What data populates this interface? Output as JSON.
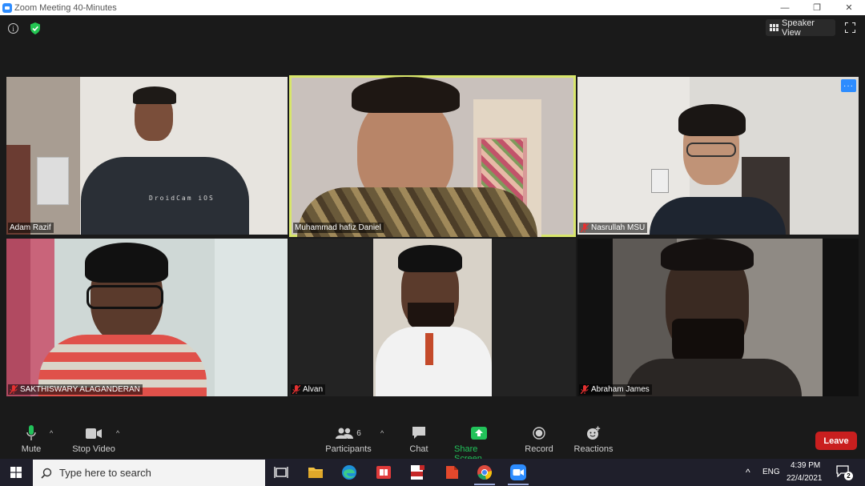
{
  "window": {
    "title": "Zoom Meeting 40-Minutes",
    "controls": [
      "—",
      "❐",
      "✕"
    ]
  },
  "header": {
    "info_glyph": "i",
    "speaker_view_label": "Speaker View"
  },
  "participants": [
    {
      "name": "Adam Razif",
      "muted": false
    },
    {
      "name": "Muhammad hafiz Daniel",
      "muted": false,
      "active_speaker": true
    },
    {
      "name": "Nasrullah MSU",
      "muted": true
    },
    {
      "name": "SAKTHISWARY ALAGANDERAN",
      "muted": true
    },
    {
      "name": "Alvan",
      "muted": true
    },
    {
      "name": "Abraham James",
      "muted": true
    }
  ],
  "shirt_print": "DroidCam iOS",
  "more_glyph": "···",
  "toolbar": {
    "mute_label": "Mute",
    "stop_video_label": "Stop Video",
    "participants_label": "Participants",
    "participants_count": "6",
    "chat_label": "Chat",
    "share_screen_label": "Share Screen",
    "record_label": "Record",
    "reactions_label": "Reactions",
    "leave_label": "Leave",
    "caret": "^"
  },
  "taskbar": {
    "search_placeholder": "Type here to search",
    "language": "ENG",
    "time": "4:39 PM",
    "date": "22/4/2021",
    "notification_count": "2",
    "tray_chevron": "^"
  },
  "colors": {
    "active_outline": "#d8e66b",
    "share_green": "#22c25a",
    "leave_red": "#c91f1f",
    "accent_blue": "#2d8cff"
  }
}
